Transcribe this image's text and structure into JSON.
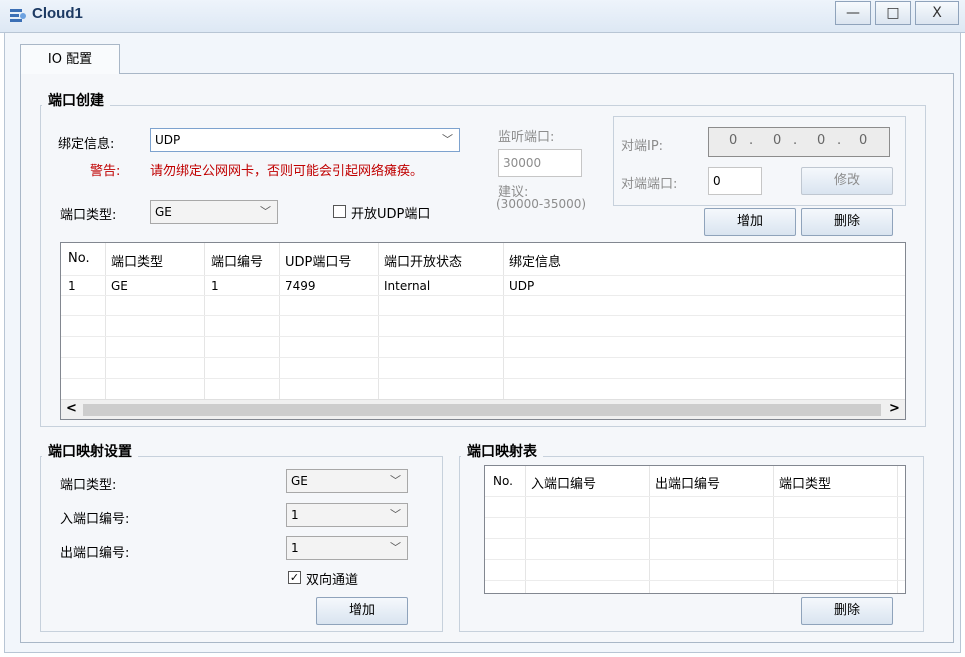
{
  "window": {
    "title": "Cloud1",
    "minimize_glyph": "—",
    "maximize_glyph": "□",
    "close_glyph": "X"
  },
  "tabs": [
    {
      "label": "IO 配置"
    }
  ],
  "port_create": {
    "title": "端口创建",
    "bind_label": "绑定信息:",
    "bind_value": "UDP",
    "warning_label": "警告:",
    "warning_text": "请勿绑定公网网卡，否则可能会引起网络瘫痪。",
    "port_type_label": "端口类型:",
    "port_type_value": "GE",
    "open_udp_label": "开放UDP端口",
    "listen_label": "监听端口:",
    "listen_value": "30000",
    "suggest_label": "建议:",
    "suggest_range": "(30000-35000)",
    "peer_ip_label": "对端IP:",
    "peer_ip": [
      "0",
      "0",
      "0",
      "0"
    ],
    "peer_port_label": "对端端口:",
    "peer_port_value": "0",
    "modify_button": "修改",
    "add_button": "增加",
    "delete_button": "删除",
    "table": {
      "headers": [
        "No.",
        "端口类型",
        "端口编号",
        "UDP端口号",
        "端口开放状态",
        "绑定信息"
      ],
      "rows": [
        [
          "1",
          "GE",
          "1",
          "7499",
          "Internal",
          "UDP"
        ]
      ]
    },
    "scroll_left": "<",
    "scroll_right": ">"
  },
  "port_map_settings": {
    "title": "端口映射设置",
    "port_type_label": "端口类型:",
    "port_type_value": "GE",
    "in_port_label": "入端口编号:",
    "in_port_value": "1",
    "out_port_label": "出端口编号:",
    "out_port_value": "1",
    "bidirectional_label": "双向通道",
    "bidirectional_checked": true,
    "add_button": "增加"
  },
  "port_map_table": {
    "title": "端口映射表",
    "headers": [
      "No.",
      "入端口编号",
      "出端口编号",
      "端口类型"
    ],
    "delete_button": "删除"
  },
  "icons": {
    "app": "cloud-app-icon",
    "dropdown": "chevron-down-icon"
  },
  "colors": {
    "warning": "#c00000",
    "titlebar": "#dde8f4",
    "title_text": "#1d3a63"
  }
}
